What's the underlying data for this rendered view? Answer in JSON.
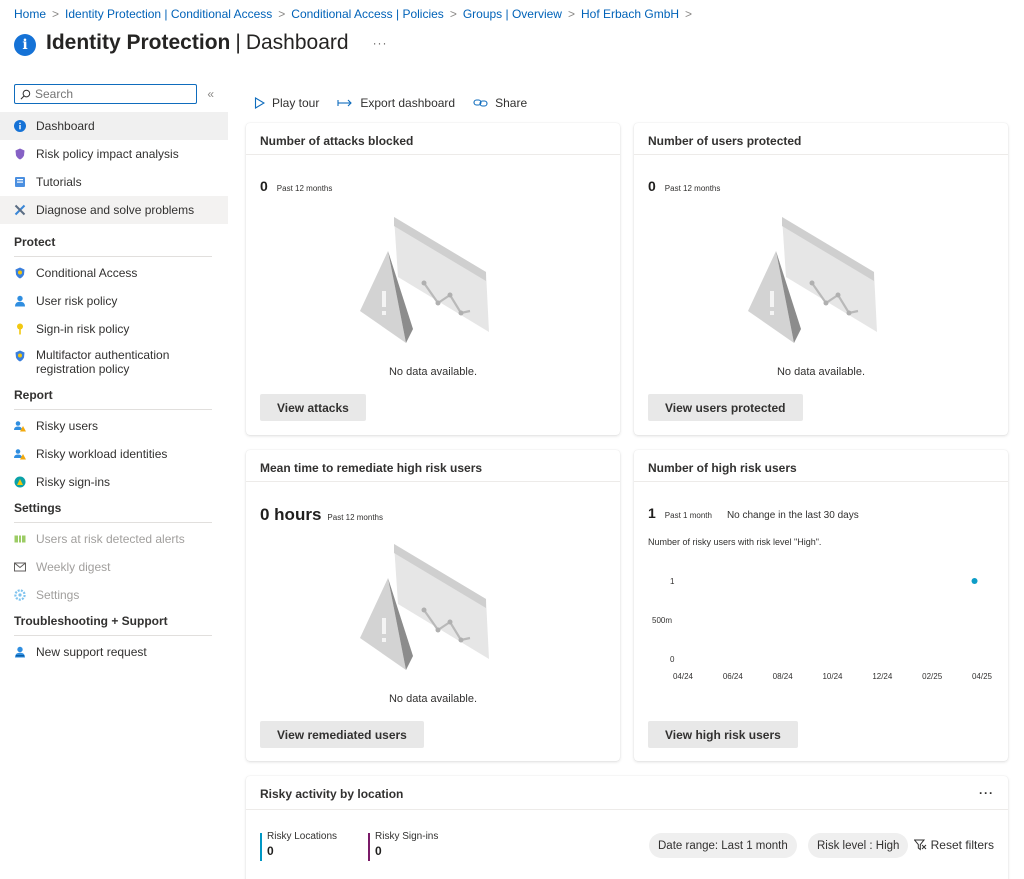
{
  "breadcrumb": [
    "Home",
    "Identity Protection | Conditional Access",
    "Conditional Access | Policies",
    "Groups | Overview",
    "Hof Erbach GmbH"
  ],
  "breadcrumb_sep": ">",
  "header": {
    "title_main": "Identity Protection",
    "title_sep": "|",
    "title_sub": "Dashboard",
    "more": "···"
  },
  "search": {
    "placeholder": "Search",
    "value": ""
  },
  "collapse": "«",
  "nav": {
    "dashboard": "Dashboard",
    "risk_policy": "Risk policy impact analysis",
    "tutorials": "Tutorials",
    "diagnose": "Diagnose and solve problems",
    "protect": "Protect",
    "conditional_access": "Conditional Access",
    "user_risk": "User risk policy",
    "signin_risk": "Sign-in risk policy",
    "mfa_line1": "Multifactor authentication",
    "mfa_line2": "registration policy",
    "report": "Report",
    "risky_users": "Risky users",
    "risky_workload": "Risky workload identities",
    "risky_signins": "Risky sign-ins",
    "settings_header": "Settings",
    "users_alerts": "Users at risk detected alerts",
    "weekly_digest": "Weekly digest",
    "settings": "Settings",
    "troubleshooting": "Troubleshooting + Support",
    "new_support": "New support request"
  },
  "toolbar": {
    "play_tour": "Play tour",
    "export": "Export dashboard",
    "share": "Share"
  },
  "cards": {
    "attacks": {
      "title": "Number of attacks blocked",
      "value": "0",
      "period": "Past 12 months",
      "nodata": "No data available.",
      "button": "View attacks"
    },
    "users_protected": {
      "title": "Number of users protected",
      "value": "0",
      "period": "Past 12 months",
      "nodata": "No data available.",
      "button": "View users protected"
    },
    "remediate": {
      "title": "Mean time to remediate high risk users",
      "value": "0 hours",
      "period": "Past 12 months",
      "nodata": "No data available.",
      "button": "View remediated users"
    },
    "high_risk": {
      "title": "Number of high risk users",
      "value": "1",
      "period": "Past 1 month",
      "note": "No change in the last 30 days",
      "desc": "Number of risky users with risk level \"High\".",
      "button": "View high risk users"
    },
    "location": {
      "title": "Risky activity by location",
      "more": "···",
      "risky_locations_label": "Risky Locations",
      "risky_locations_value": "0",
      "risky_signins_label": "Risky Sign-ins",
      "risky_signins_value": "0",
      "date_range": "Date range: Last 1 month",
      "risk_level": "Risk level : High",
      "reset": "Reset filters"
    }
  },
  "colors": {
    "accent": "#0f6cbd",
    "teal": "#0097c4",
    "purple": "#7a1a68",
    "point": "#0d9dc7"
  },
  "chart_data": {
    "type": "scatter",
    "categories": [
      "04/24",
      "06/24",
      "08/24",
      "10/24",
      "12/24",
      "02/25",
      "04/25"
    ],
    "y_ticks": [
      "1",
      "500m",
      "0"
    ],
    "ylim": [
      0,
      1
    ],
    "series": [
      {
        "points": [
          {
            "x": "03/25",
            "y": 1
          }
        ]
      }
    ],
    "grid": false
  }
}
